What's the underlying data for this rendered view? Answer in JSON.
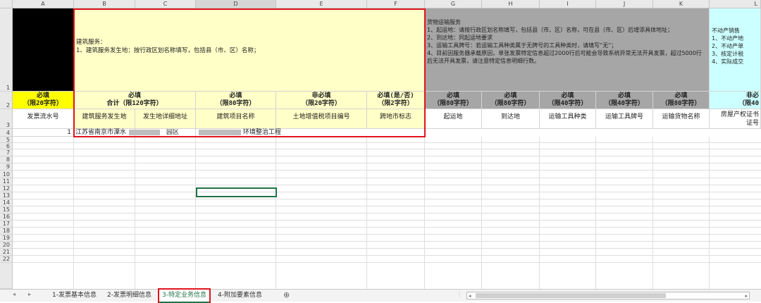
{
  "columns": [
    "A",
    "B",
    "C",
    "D",
    "E",
    "F",
    "G",
    "H",
    "I",
    "J",
    "K",
    "L"
  ],
  "rows": [
    "1",
    "2",
    "3",
    "4",
    "5",
    "6",
    "7",
    "8",
    "9",
    "10",
    "11",
    "12",
    "13",
    "14",
    "15",
    "16",
    "17",
    "18",
    "19",
    "20",
    "21",
    "22"
  ],
  "row1": {
    "construction_note": "建筑服务：\n1、建筑服务发生地：按行政区划名称填写，包括县（市、区）名称；",
    "transport_note": "货物运输服务\n1、起运地：请按行政区划名称填写，包括县（市、区）名称，可在县（市、区）后增添具体地址；\n2、到达地：同起运地要求\n3、运输工具牌号：若运输工具种类属于无牌号的工具种类时，请填写“无”；\n4、目前因服务器承载原因，单张发票特定信息超过2000行后可能会导致系统异常无法开具发票，超过5000行后无法开具发票，请注意特定信息明细行数。",
    "realestate_note": "不动产销售\n1、不动产地\n2、不动产单\n3、核定计税\n4、实际成交"
  },
  "row2": {
    "A": "必填\n（限20字符）",
    "BC": "必填\n合计（限120字符）",
    "D": "必填\n（限80字符）",
    "E": "非必填\n（限20字符）",
    "F": "必填(是/否)\n（限2字符）",
    "G": "必填\n（限80字符）",
    "H": "必填\n（限80字符）",
    "I": "必填\n（限40字符）",
    "J": "必填\n（限40字符）",
    "K": "必填\n（限80字符）",
    "L": "非必\n（限40"
  },
  "row3": {
    "A": "发票流水号",
    "B": "建筑服务发生地",
    "C": "发生地详细地址",
    "D": "建筑项目名称",
    "E": "土地增值税项目编号",
    "F": "跨地市标志",
    "G": "起运地",
    "H": "到达地",
    "I": "运输工具种类",
    "J": "运输工具牌号",
    "K": "运输货物名称",
    "L": "房屋产权证书\n证号"
  },
  "row4": {
    "A": "1",
    "B": "江苏省南京市溧水",
    "C": "园区",
    "D": "环境整治工程"
  },
  "tabs": [
    "1-发票基本信息",
    "2-发票明细信息",
    "3-特定业务信息",
    "4-附加要素信息"
  ],
  "active_tab": "3-特定业务信息",
  "add_sheet": "⊕",
  "colors": {
    "yellow": "#ffffc8",
    "gray": "#a6a6a6",
    "cyan": "#ccffff",
    "highlight": "#ffff00",
    "red": "#e0141e",
    "black": "#000000"
  }
}
